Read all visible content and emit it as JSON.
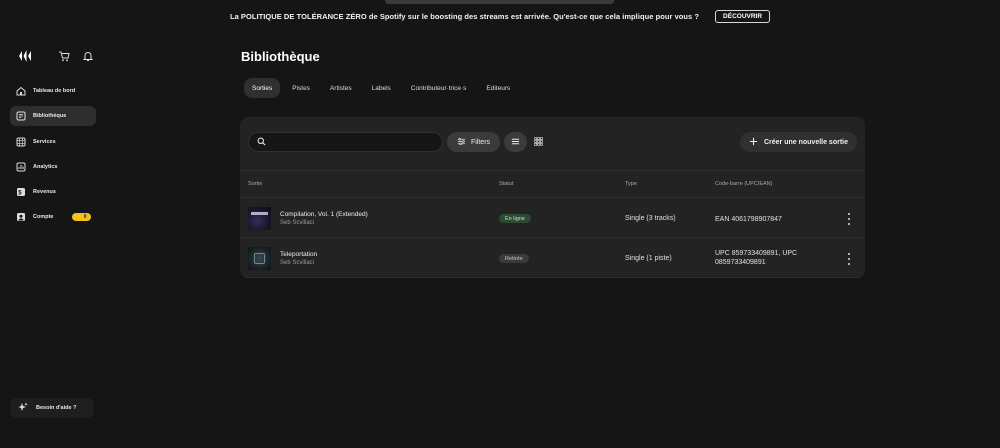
{
  "banner": {
    "text": "La POLITIQUE DE TOLÉRANCE ZÉRO de Spotify sur le boosting des streams est arrivée. Qu'est-ce que cela implique pour vous ?",
    "button": "DÉCOUVRIR"
  },
  "header_icons": [
    "logo-icon",
    "cart-icon",
    "bell-icon"
  ],
  "sidebar": {
    "items": [
      {
        "label": "Tableau de bord",
        "icon": "home-icon"
      },
      {
        "label": "Bibliothèque",
        "icon": "library-icon",
        "active": true
      },
      {
        "label": "Services",
        "icon": "grid-icon"
      },
      {
        "label": "Analytics",
        "icon": "chart-icon"
      },
      {
        "label": "Revenus",
        "icon": "dollar-icon"
      },
      {
        "label": "Compte",
        "icon": "user-icon",
        "badge": "0"
      }
    ],
    "help": "Besoin d'aide ?"
  },
  "main": {
    "title": "Bibliothèque",
    "tabs": [
      "Sorties",
      "Pistes",
      "Artistes",
      "Labels",
      "Contributeur·trice·s",
      "Editeurs"
    ],
    "active_tab": "Sorties",
    "search": {
      "placeholder": "",
      "value": ""
    },
    "filters_label": "Filters",
    "create_label": "Créer une nouvelle sortie",
    "table": {
      "headers": [
        "Sortie",
        "Statut",
        "Type",
        "Code-barre (UPC/EAN)"
      ],
      "rows": [
        {
          "title": "Compilation, Vol. 1 (Extended)",
          "artist": "Seb Scviliaci",
          "status": "En ligne",
          "type": "Single (3 tracks)",
          "barcode": "EAN 4061798907847"
        },
        {
          "title": "Teleportation",
          "artist": "Seb Scviliaci",
          "status": "Retirée",
          "type": "Single (1 piste)",
          "barcode": "UPC 859733409891, UPC 0859733409891"
        }
      ]
    }
  },
  "colors": {
    "background": "#151515",
    "card": "#232323",
    "badge": "#f4c21b",
    "status_online": "#2f4a32"
  }
}
